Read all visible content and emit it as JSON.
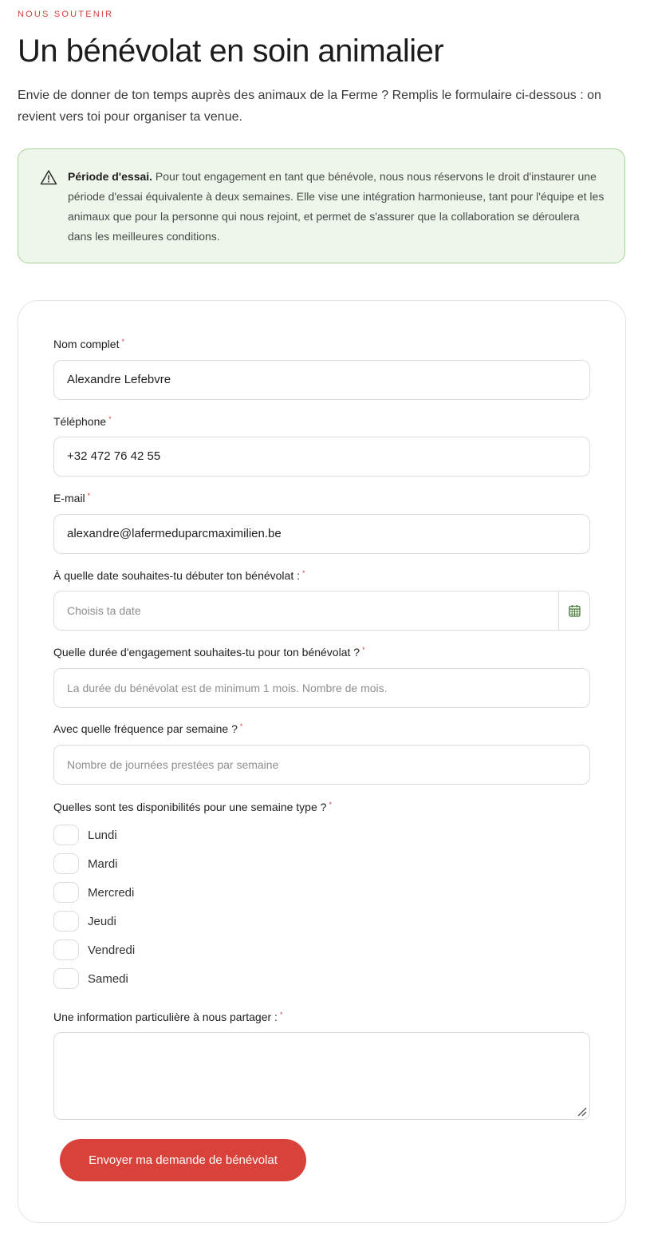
{
  "header": {
    "eyebrow": "NOUS SOUTENIR",
    "title": "Un bénévolat en soin animalier",
    "intro": "Envie de donner de ton temps auprès des animaux de la Ferme ? Remplis le formulaire ci-dessous : on revient vers toi pour organiser ta venue."
  },
  "notice": {
    "icon": "warning-triangle-icon",
    "bold": "Période d'essai.",
    "text": " Pour tout engagement en tant que bénévole, nous nous réservons le droit d'instaurer une période d'essai équivalente à deux semaines. Elle vise une intégration harmonieuse, tant pour l'équipe et les animaux que pour la personne qui nous rejoint, et permet de s'assurer que la collaboration se déroulera dans les meilleures conditions.",
    "background": "#eef5ea",
    "border": "#a9d29a"
  },
  "form": {
    "required_marker": "*",
    "name": {
      "label": "Nom complet",
      "value": "Alexandre Lefebvre"
    },
    "phone": {
      "label": "Téléphone",
      "value": "+32 472 76 42 55"
    },
    "email": {
      "label": "E-mail",
      "value": "alexandre@lafermeduparcmaximilien.be"
    },
    "start_date": {
      "label": "À quelle date souhaites-tu débuter ton bénévolat :",
      "placeholder": "Choisis ta date",
      "icon": "calendar-icon"
    },
    "duration": {
      "label": "Quelle durée d'engagement souhaites-tu pour ton bénévolat ?",
      "placeholder": "La durée du bénévolat est de minimum 1 mois. Nombre de mois."
    },
    "frequency": {
      "label": "Avec quelle fréquence par semaine ?",
      "placeholder": "Nombre de journées prestées par semaine"
    },
    "availability": {
      "label": "Quelles sont tes disponibilités pour une semaine type ?",
      "days": [
        {
          "label": "Lundi",
          "checked": false
        },
        {
          "label": "Mardi",
          "checked": false
        },
        {
          "label": "Mercredi",
          "checked": false
        },
        {
          "label": "Jeudi",
          "checked": false
        },
        {
          "label": "Vendredi",
          "checked": false
        },
        {
          "label": "Samedi",
          "checked": false
        }
      ]
    },
    "info": {
      "label": "Une information particulière à nous partager :",
      "value": ""
    },
    "submit_label": "Envoyer ma demande de bénévolat"
  },
  "colors": {
    "accent": "#d9423a",
    "calendar_icon": "#4a7a3a"
  }
}
